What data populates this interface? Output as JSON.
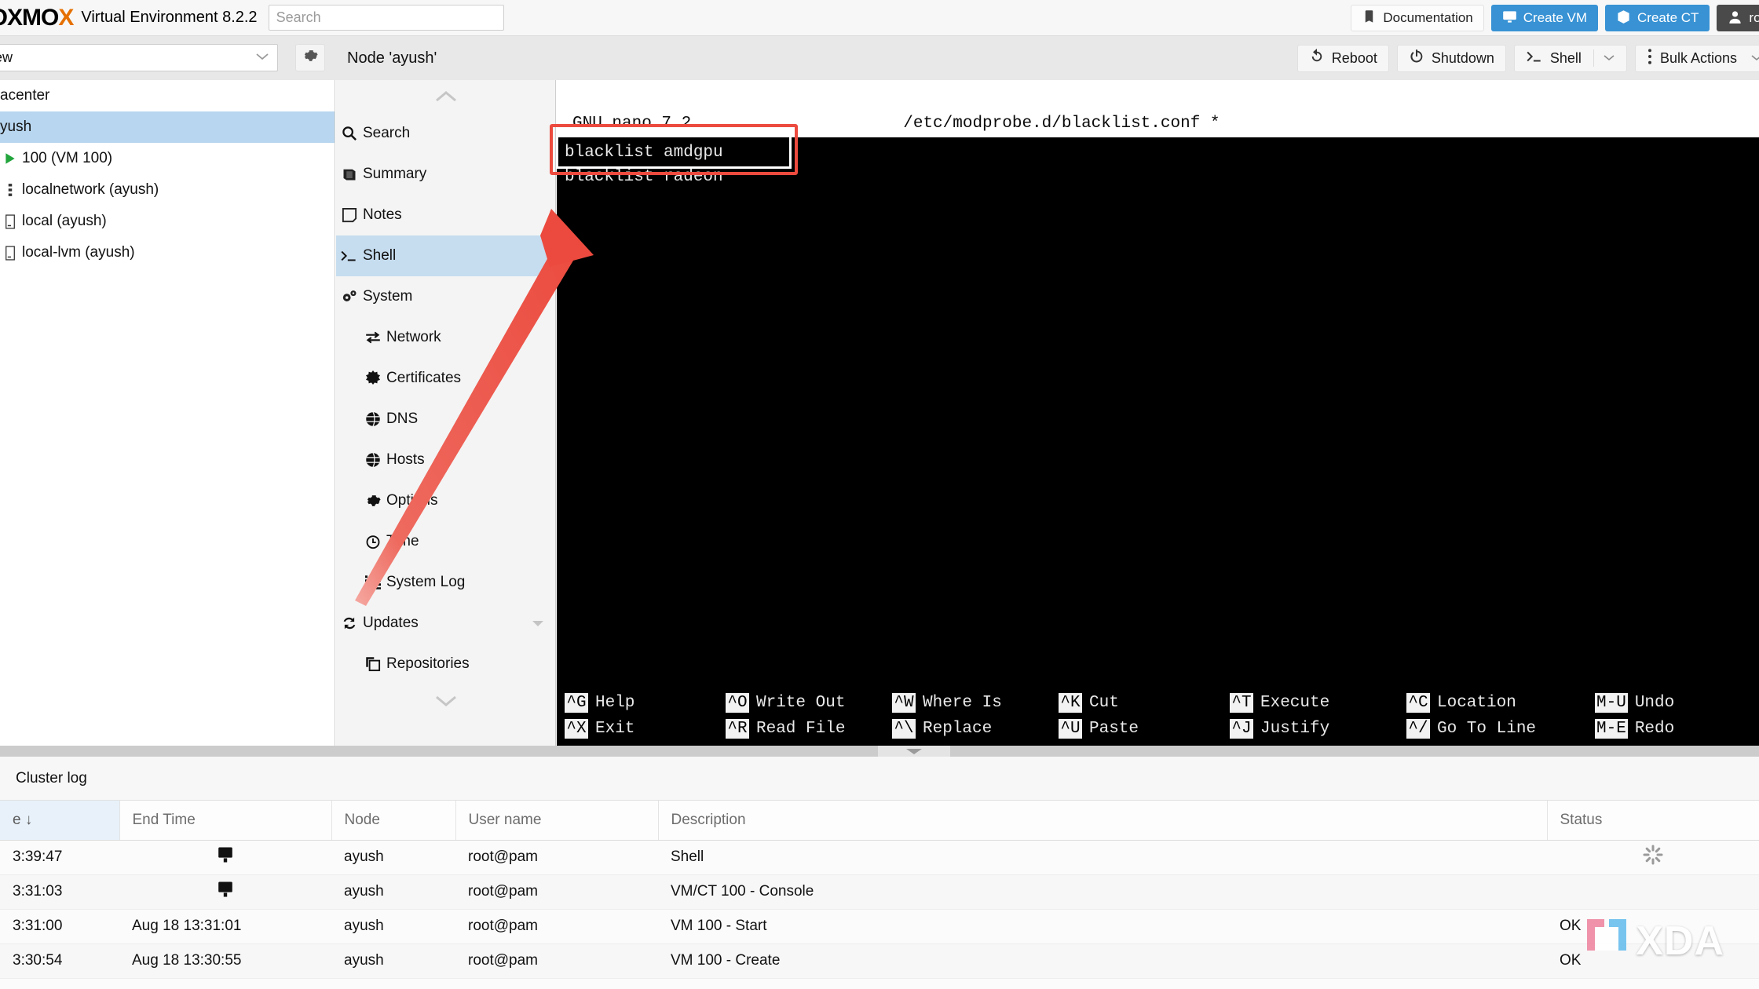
{
  "header": {
    "logo_main": "ROXMO",
    "logo_x": "X",
    "product": "Virtual Environment 8.2.2",
    "search_placeholder": "Search",
    "documentation_label": "Documentation",
    "create_vm_label": "Create VM",
    "create_ct_label": "Create CT",
    "user_label": "roo",
    "accent_blue": "#3892d4",
    "logo_orange": "#e57000"
  },
  "viewbar": {
    "view_value": "ew",
    "chevron": "⌄",
    "gear_icon": "gear-icon"
  },
  "node": {
    "title": "Node 'ayush'",
    "actions": [
      {
        "label": "Reboot",
        "icon": "↺",
        "has_split": false
      },
      {
        "label": "Shutdown",
        "icon": "⏻",
        "has_split": false
      },
      {
        "label": "Shell",
        "icon": ">_",
        "has_split": true
      },
      {
        "label": "Bulk Actions",
        "icon": "⋮",
        "has_split": true
      }
    ]
  },
  "tree": {
    "items": [
      {
        "label": "acenter",
        "icon": "",
        "selected": false,
        "level": 0
      },
      {
        "label": "yush",
        "icon": "",
        "selected": true,
        "level": 0
      },
      {
        "label": "100 (VM 100)",
        "icon": "▶",
        "selected": false,
        "level": 1
      },
      {
        "label": "localnetwork (ayush)",
        "icon": "⋮",
        "selected": false,
        "level": 1
      },
      {
        "label": "local (ayush)",
        "icon": "❑",
        "selected": false,
        "level": 1
      },
      {
        "label": "local-lvm (ayush)",
        "icon": "❑",
        "selected": false,
        "level": 1
      }
    ]
  },
  "menu": {
    "collapse_up": "⌃",
    "collapse_down": "⌄",
    "items": [
      {
        "label": "Search",
        "icon": "search-icon",
        "glyph": "⚲",
        "selected": false,
        "indent": false,
        "expander": false
      },
      {
        "label": "Summary",
        "icon": "book-icon",
        "glyph": "◧",
        "selected": false,
        "indent": false,
        "expander": false
      },
      {
        "label": "Notes",
        "icon": "note-icon",
        "glyph": "⬚",
        "selected": false,
        "indent": false,
        "expander": false
      },
      {
        "label": "Shell",
        "icon": "terminal-icon",
        "glyph": ">_",
        "selected": true,
        "indent": false,
        "expander": false
      },
      {
        "label": "System",
        "icon": "gears-icon",
        "glyph": "⚙",
        "selected": false,
        "indent": false,
        "expander": true
      },
      {
        "label": "Network",
        "icon": "network-icon",
        "glyph": "⇄",
        "selected": false,
        "indent": true,
        "expander": false
      },
      {
        "label": "Certificates",
        "icon": "certificate-icon",
        "glyph": "✸",
        "selected": false,
        "indent": true,
        "expander": false
      },
      {
        "label": "DNS",
        "icon": "globe-icon",
        "glyph": "◕",
        "selected": false,
        "indent": true,
        "expander": false
      },
      {
        "label": "Hosts",
        "icon": "globe-icon",
        "glyph": "◕",
        "selected": false,
        "indent": true,
        "expander": false
      },
      {
        "label": "Options",
        "icon": "gear-icon",
        "glyph": "⚙",
        "selected": false,
        "indent": true,
        "expander": false
      },
      {
        "label": "Time",
        "icon": "clock-icon",
        "glyph": "◷",
        "selected": false,
        "indent": true,
        "expander": false
      },
      {
        "label": "System Log",
        "icon": "list-icon",
        "glyph": "☰",
        "selected": false,
        "indent": true,
        "expander": false
      },
      {
        "label": "Updates",
        "icon": "refresh-icon",
        "glyph": "↻",
        "selected": false,
        "indent": false,
        "expander": true
      },
      {
        "label": "Repositories",
        "icon": "copy-icon",
        "glyph": "⧉",
        "selected": false,
        "indent": true,
        "expander": false
      }
    ]
  },
  "terminal": {
    "header_left": "GNU nano 7.2",
    "header_file": "/etc/modprobe.d/blacklist.conf *",
    "lines": [
      "blacklist amdgpu",
      "blacklist radeon"
    ],
    "shortcuts": [
      [
        {
          "key": "^G",
          "label": "Help"
        },
        {
          "key": "^X",
          "label": "Exit"
        }
      ],
      [
        {
          "key": "^O",
          "label": "Write Out"
        },
        {
          "key": "^R",
          "label": "Read File"
        }
      ],
      [
        {
          "key": "^W",
          "label": "Where Is"
        },
        {
          "key": "^\\",
          "label": "Replace"
        }
      ],
      [
        {
          "key": "^K",
          "label": "Cut"
        },
        {
          "key": "^U",
          "label": "Paste"
        }
      ],
      [
        {
          "key": "^T",
          "label": "Execute"
        },
        {
          "key": "^J",
          "label": "Justify"
        }
      ],
      [
        {
          "key": "^C",
          "label": "Location"
        },
        {
          "key": "^/",
          "label": "Go To Line"
        }
      ],
      [
        {
          "key": "M-U",
          "label": "Undo"
        },
        {
          "key": "M-E",
          "label": "Redo"
        }
      ]
    ]
  },
  "annotation": {
    "highlight_color": "#ec4a3e",
    "arrow_color": "#ec4a3e"
  },
  "cluster_log": {
    "title": "Cluster log",
    "columns": [
      "e ↓",
      "End Time",
      "Node",
      "User name",
      "Description",
      "Status"
    ],
    "rows": [
      {
        "start": "3:39:47",
        "end": "",
        "end_icon": "monitor-icon",
        "node": "ayush",
        "user": "root@pam",
        "description": "Shell",
        "status": "",
        "status_icon": "spinner-icon"
      },
      {
        "start": "3:31:03",
        "end": "",
        "end_icon": "monitor-icon",
        "node": "ayush",
        "user": "root@pam",
        "description": "VM/CT 100 - Console",
        "status": "",
        "status_icon": ""
      },
      {
        "start": "3:31:00",
        "end": "Aug 18 13:31:01",
        "end_icon": "",
        "node": "ayush",
        "user": "root@pam",
        "description": "VM 100 - Start",
        "status": "OK",
        "status_icon": ""
      },
      {
        "start": "3:30:54",
        "end": "Aug 18 13:30:55",
        "end_icon": "",
        "node": "ayush",
        "user": "root@pam",
        "description": "VM 100 - Create",
        "status": "OK",
        "status_icon": ""
      }
    ]
  },
  "watermark": {
    "text": "XDA"
  }
}
